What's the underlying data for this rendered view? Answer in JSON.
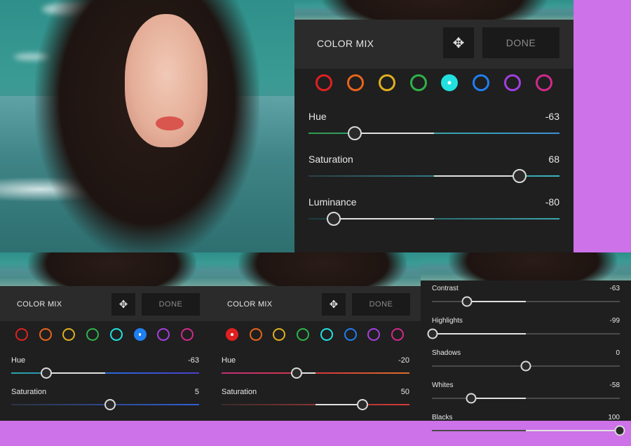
{
  "photo_alt": "portrait on beach",
  "main_panel": {
    "title": "COLOR MIX",
    "done_label": "DONE",
    "swatch_colors": [
      "#e02020",
      "#e8641c",
      "#e0b020",
      "#2fb34a",
      "#22e0e0",
      "#1f7ff0",
      "#a33fe0",
      "#d02a8a"
    ],
    "selected_index": 4,
    "sliders": [
      {
        "label": "Hue",
        "value": "-63",
        "level": -63,
        "track": "linear-gradient(90deg,#2f9a4a,#3aa6a0 45%,#3c8fd6)"
      },
      {
        "label": "Saturation",
        "value": "68",
        "level": 68,
        "track": "linear-gradient(90deg,#2c3f44,#37b7c4)"
      },
      {
        "label": "Luminance",
        "value": "-80",
        "level": -80,
        "track": "linear-gradient(90deg,#1c3a3d,#3aa6ad)"
      }
    ]
  },
  "panel_a": {
    "title": "COLOR MIX",
    "done_label": "DONE",
    "swatch_colors": [
      "#e02020",
      "#e8641c",
      "#e0b020",
      "#2fb34a",
      "#22e0e0",
      "#1f7ff0",
      "#a33fe0",
      "#d02a8a"
    ],
    "selected_index": 5,
    "sliders": [
      {
        "label": "Hue",
        "value": "-63",
        "level": -63,
        "track": "linear-gradient(90deg,#2aa6a6,#2f5fd8 60%,#4a3fd0)"
      },
      {
        "label": "Saturation",
        "value": "5",
        "level": 5,
        "track": "linear-gradient(90deg,#2c3340,#2f5fd8)"
      }
    ]
  },
  "panel_b": {
    "title": "COLOR MIX",
    "done_label": "DONE",
    "swatch_colors": [
      "#e02020",
      "#e8641c",
      "#e0b020",
      "#2fb34a",
      "#22e0e0",
      "#1f7ff0",
      "#a33fe0",
      "#d02a8a"
    ],
    "selected_index": 0,
    "sliders": [
      {
        "label": "Hue",
        "value": "-20",
        "level": -20,
        "track": "linear-gradient(90deg,#c0307a,#d83a3a 55%,#d9702a)"
      },
      {
        "label": "Saturation",
        "value": "50",
        "level": 50,
        "track": "linear-gradient(90deg,#3a2b2b,#d83a3a)"
      }
    ]
  },
  "panel_c": {
    "sliders": [
      {
        "label": "Contrast",
        "value": "-63",
        "level": -63
      },
      {
        "label": "Highlights",
        "value": "-99",
        "level": -99
      },
      {
        "label": "Shadows",
        "value": "0",
        "level": 0
      },
      {
        "label": "Whites",
        "value": "-58",
        "level": -58
      },
      {
        "label": "Blacks",
        "value": "100",
        "level": 100
      }
    ]
  }
}
